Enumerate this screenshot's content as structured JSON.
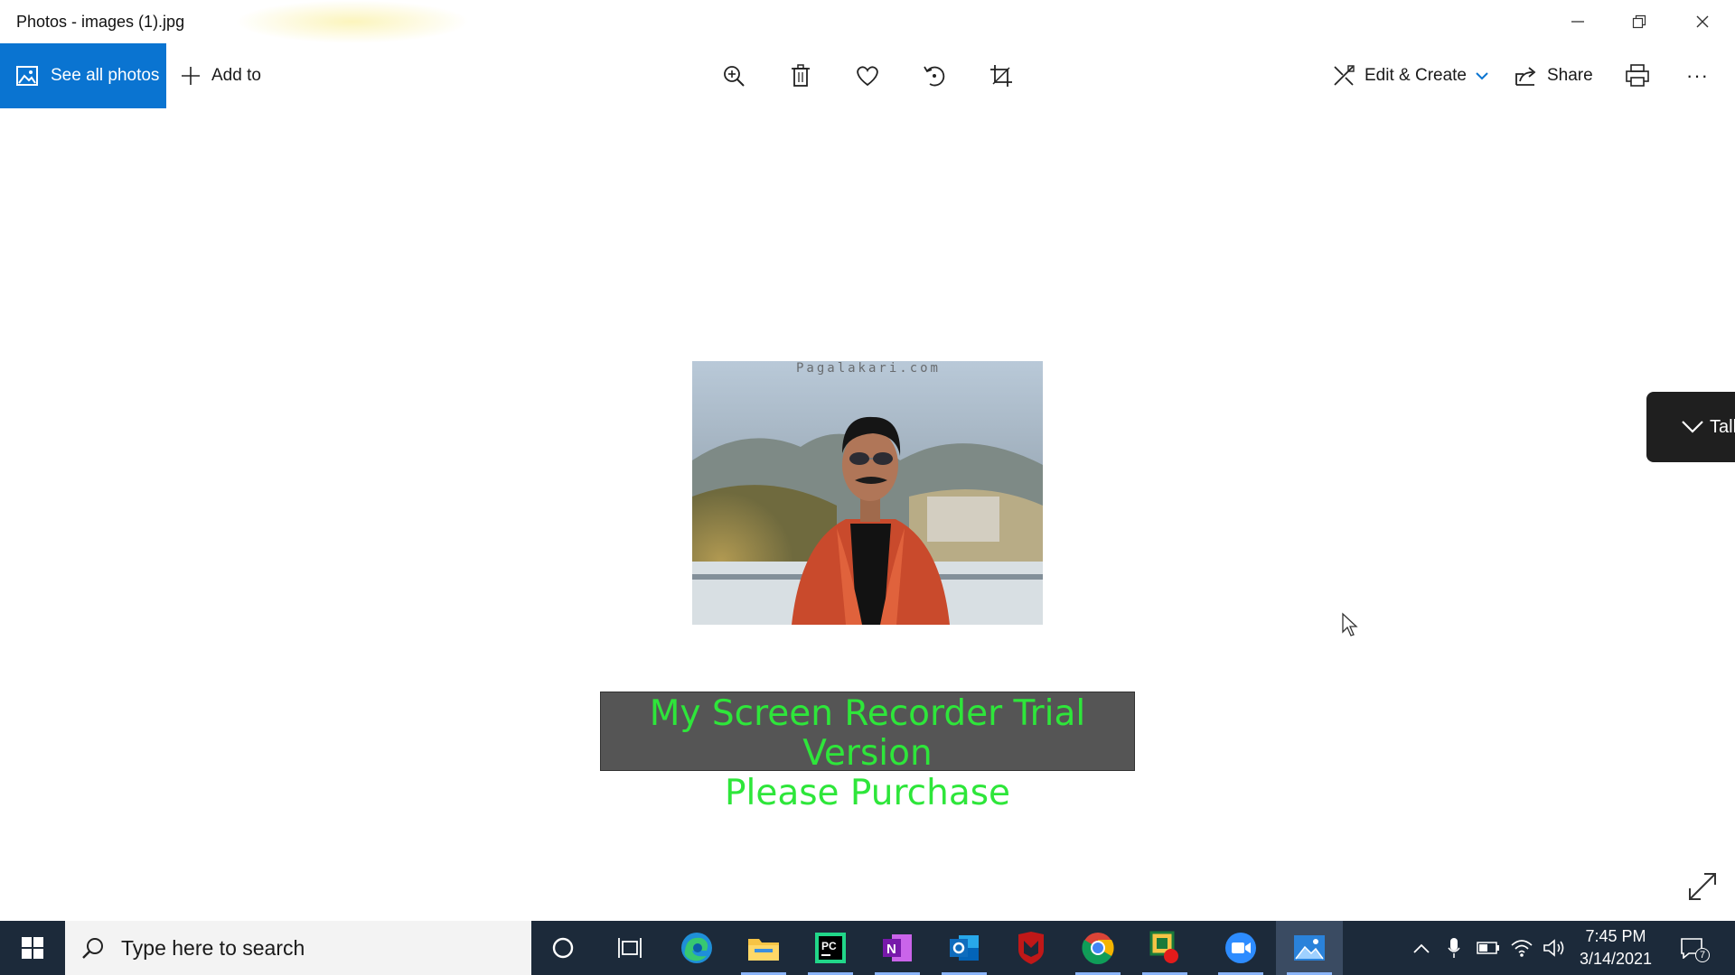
{
  "window": {
    "title": "Photos - images (1).jpg"
  },
  "toolbar": {
    "see_all_label": "See all photos",
    "add_to_label": "Add to",
    "edit_create_label": "Edit & Create",
    "share_label": "Share",
    "more_label": "···",
    "icons": [
      "zoom-icon",
      "delete-icon",
      "favorite-icon",
      "rotate-icon",
      "crop-icon",
      "print-icon"
    ]
  },
  "viewer": {
    "photo_watermark_text": "Pagalakari.com",
    "recorder_line1": "My Screen Recorder Trial Version",
    "recorder_line2": "Please Purchase",
    "talk_label": "Talk",
    "recorder_text_color": "#2ee63a"
  },
  "taskbar": {
    "search_placeholder": "Type here to search",
    "time": "7:45 PM",
    "date": "3/14/2021",
    "notification_count": "7",
    "apps": [
      "cortana",
      "task-view",
      "edge",
      "file-explorer",
      "pycharm",
      "onenote",
      "outlook",
      "mcafee",
      "chrome",
      "screen-recorder",
      "zoom",
      "photos"
    ]
  },
  "colors": {
    "accent": "#0a74d1",
    "taskbar_bg": "#1c2a3a"
  }
}
